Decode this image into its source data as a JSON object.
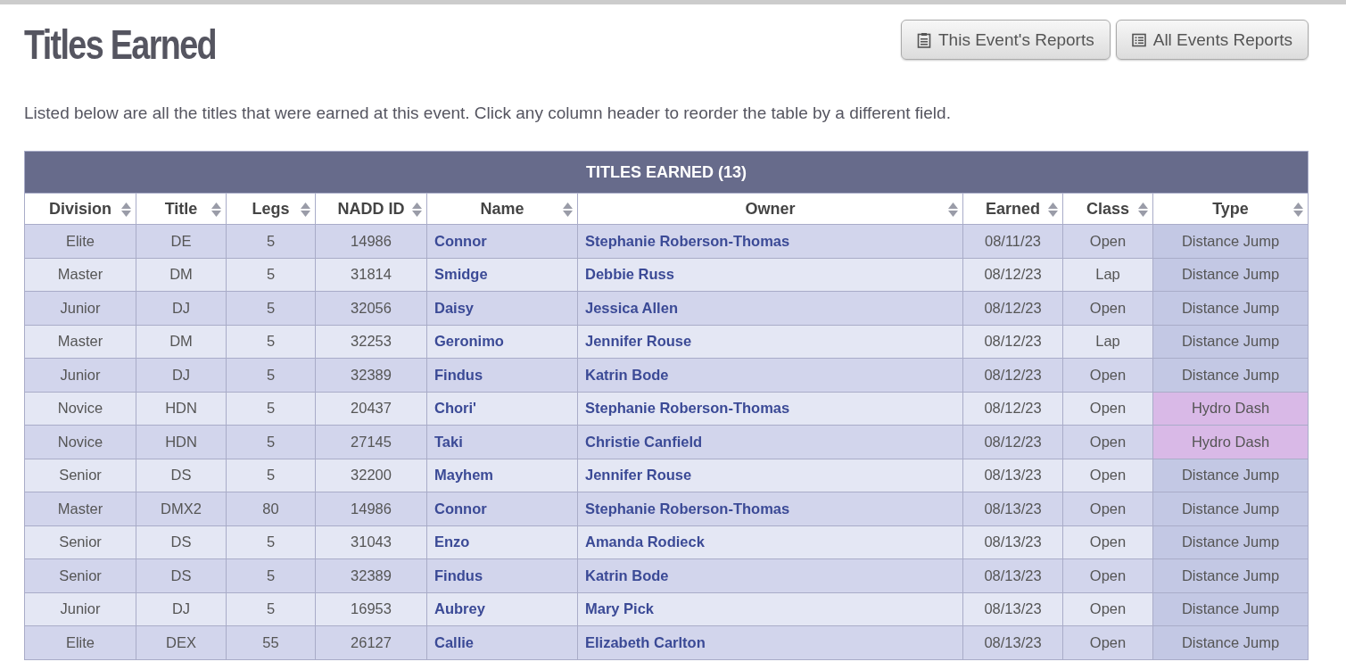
{
  "heading": "Titles Earned",
  "buttons": [
    {
      "label": "This Event's Reports",
      "kind": "clipboard"
    },
    {
      "label": "All Events Reports",
      "kind": "list"
    }
  ],
  "intro": "Listed below are all the titles that were earned at this event. Click any column header to reorder the table by a different field.",
  "table": {
    "caption": "TITLES EARNED (13)",
    "columns": [
      "Division",
      "Title",
      "Legs",
      "NADD ID",
      "Name",
      "Owner",
      "Earned",
      "Class",
      "Type"
    ],
    "rows": [
      {
        "division": "Elite",
        "title": "DE",
        "legs": "5",
        "nadd_id": "14986",
        "name": "Connor",
        "owner": "Stephanie Roberson-Thomas",
        "earned": "08/11/23",
        "class": "Open",
        "type": "Distance Jump",
        "color": "#c3c8e4"
      },
      {
        "division": "Master",
        "title": "DM",
        "legs": "5",
        "nadd_id": "31814",
        "name": "Smidge",
        "owner": "Debbie Russ",
        "earned": "08/12/23",
        "class": "Lap",
        "type": "Distance Jump",
        "color": "#c3c8e4"
      },
      {
        "division": "Junior",
        "title": "DJ",
        "legs": "5",
        "nadd_id": "32056",
        "name": "Daisy",
        "owner": "Jessica Allen",
        "earned": "08/12/23",
        "class": "Open",
        "type": "Distance Jump",
        "color": "#c3c8e4"
      },
      {
        "division": "Master",
        "title": "DM",
        "legs": "5",
        "nadd_id": "32253",
        "name": "Geronimo",
        "owner": "Jennifer Rouse",
        "earned": "08/12/23",
        "class": "Lap",
        "type": "Distance Jump",
        "color": "#c3c8e4"
      },
      {
        "division": "Junior",
        "title": "DJ",
        "legs": "5",
        "nadd_id": "32389",
        "name": "Findus",
        "owner": "Katrin Bode",
        "earned": "08/12/23",
        "class": "Open",
        "type": "Distance Jump",
        "color": "#c3c8e4"
      },
      {
        "division": "Novice",
        "title": "HDN",
        "legs": "5",
        "nadd_id": "20437",
        "name": "Chori'",
        "owner": "Stephanie Roberson-Thomas",
        "earned": "08/12/23",
        "class": "Open",
        "type": "Hydro Dash",
        "color": "#d9b9e7"
      },
      {
        "division": "Novice",
        "title": "HDN",
        "legs": "5",
        "nadd_id": "27145",
        "name": "Taki",
        "owner": "Christie Canfield",
        "earned": "08/12/23",
        "class": "Open",
        "type": "Hydro Dash",
        "color": "#d9b9e7"
      },
      {
        "division": "Senior",
        "title": "DS",
        "legs": "5",
        "nadd_id": "32200",
        "name": "Mayhem",
        "owner": "Jennifer Rouse",
        "earned": "08/13/23",
        "class": "Open",
        "type": "Distance Jump",
        "color": "#c3c8e4"
      },
      {
        "division": "Master",
        "title": "DMX2",
        "legs": "80",
        "nadd_id": "14986",
        "name": "Connor",
        "owner": "Stephanie Roberson-Thomas",
        "earned": "08/13/23",
        "class": "Open",
        "type": "Distance Jump",
        "color": "#c3c8e4"
      },
      {
        "division": "Senior",
        "title": "DS",
        "legs": "5",
        "nadd_id": "31043",
        "name": "Enzo",
        "owner": "Amanda Rodieck",
        "earned": "08/13/23",
        "class": "Open",
        "type": "Distance Jump",
        "color": "#c3c8e4"
      },
      {
        "division": "Senior",
        "title": "DS",
        "legs": "5",
        "nadd_id": "32389",
        "name": "Findus",
        "owner": "Katrin Bode",
        "earned": "08/13/23",
        "class": "Open",
        "type": "Distance Jump",
        "color": "#c3c8e4"
      },
      {
        "division": "Junior",
        "title": "DJ",
        "legs": "5",
        "nadd_id": "16953",
        "name": "Aubrey",
        "owner": "Mary Pick",
        "earned": "08/13/23",
        "class": "Open",
        "type": "Distance Jump",
        "color": "#c3c8e4"
      },
      {
        "division": "Elite",
        "title": "DEX",
        "legs": "55",
        "nadd_id": "26127",
        "name": "Callie",
        "owner": "Elizabeth Carlton",
        "earned": "08/13/23",
        "class": "Open",
        "type": "Distance Jump",
        "color": "#c3c8e4"
      }
    ]
  }
}
